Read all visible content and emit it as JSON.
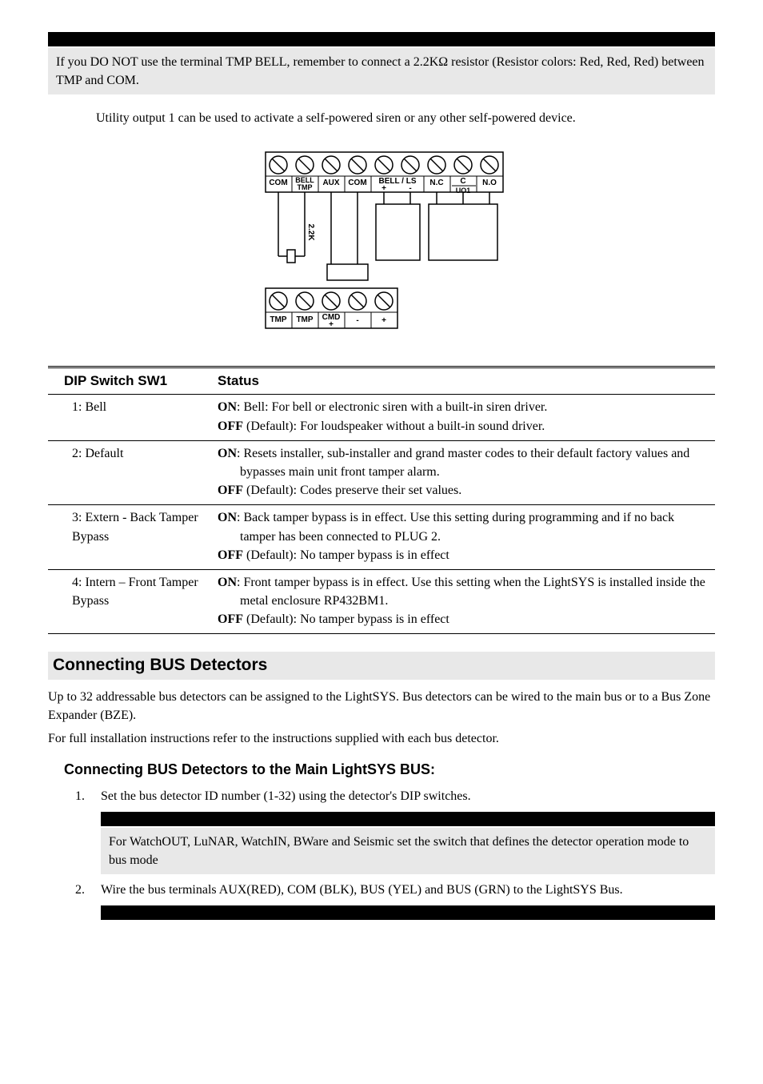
{
  "note1": "If you DO NOT use the terminal TMP BELL, remember to connect a 2.2KΩ resistor (Resistor colors: Red, Red, Red) between TMP and COM.",
  "utility_line": "Utility output 1 can be used to activate a self-powered siren or any other self-powered device.",
  "diagram": {
    "top_labels": [
      "COM",
      "BELL TMP",
      "AUX",
      "COM",
      "BELL / LS +",
      "-",
      "N.C",
      "C UO1",
      "N.O"
    ],
    "resistor_label": "2.2K",
    "bottom_labels": [
      "TMP",
      "TMP",
      "CMD +",
      "-",
      "+"
    ]
  },
  "table": {
    "headers": [
      "DIP Switch SW1",
      "Status"
    ],
    "rows": [
      {
        "label": "1: Bell",
        "on": "Bell: For bell or electronic siren with a built-in siren driver.",
        "off": "(Default): For loudspeaker without a built-in sound driver."
      },
      {
        "label": "2: Default",
        "on": "Resets installer, sub-installer and grand master codes to their default factory values and bypasses main unit front tamper alarm.",
        "off": "(Default): Codes preserve their set values."
      },
      {
        "label": "3: Extern - Back Tamper Bypass",
        "on": "Back tamper bypass is in effect. Use this setting during programming and if no back tamper has been connected to PLUG 2.",
        "off": "(Default): No tamper bypass is in effect"
      },
      {
        "label": "4: Intern – Front  Tamper Bypass",
        "on": "Front tamper bypass is in effect. Use this setting when the LightSYS is installed inside the metal enclosure RP432BM1.",
        "off": "(Default): No tamper bypass is in effect"
      }
    ]
  },
  "section_title": "Connecting BUS Detectors",
  "section_p1": "Up to 32 addressable bus detectors can be assigned to the LightSYS. Bus detectors can be wired to the main bus or to a Bus Zone Expander (BZE).",
  "section_p2": "For full installation instructions refer to the instructions supplied with each bus detector.",
  "subsection_title": "Connecting BUS Detectors to the Main LightSYS BUS:",
  "steps": {
    "s1": "Set the bus detector ID number (1-32) using the detector's DIP switches.",
    "s1_note": "For WatchOUT, LuNAR,  WatchIN, BWare and Seismic set the switch that defines the detector operation mode to bus mode",
    "s2": "Wire the bus terminals AUX(RED), COM (BLK), BUS (YEL) and BUS (GRN) to the LightSYS Bus."
  },
  "labels": {
    "on": "ON",
    "off": "OFF"
  }
}
